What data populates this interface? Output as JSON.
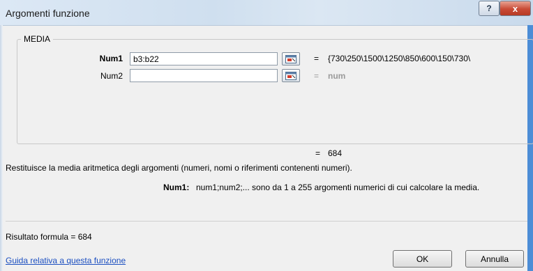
{
  "window": {
    "title": "Argomenti funzione",
    "help_symbol": "?",
    "close_symbol": "x"
  },
  "function_group": {
    "name": "MEDIA",
    "args": [
      {
        "label": "Num1",
        "value": "b3:b22",
        "result": "{730\\250\\1500\\1250\\850\\600\\150\\730\\"
      },
      {
        "label": "Num2",
        "value": "",
        "result": "num"
      }
    ],
    "equals": "="
  },
  "result_line": {
    "equals": "=",
    "value": "684"
  },
  "description": "Restituisce la media aritmetica degli argomenti (numeri, nomi o riferimenti contenenti numeri).",
  "arg_help": {
    "label": "Num1:",
    "text": "num1;num2;... sono da 1 a 255 argomenti numerici di cui calcolare la media."
  },
  "formula_result": "Risultato formula =   684",
  "help_link": "Guida relativa a questa funzione",
  "buttons": {
    "ok": "OK",
    "cancel": "Annulla"
  },
  "icons": {
    "collapse_dialog": "range-select-icon"
  }
}
